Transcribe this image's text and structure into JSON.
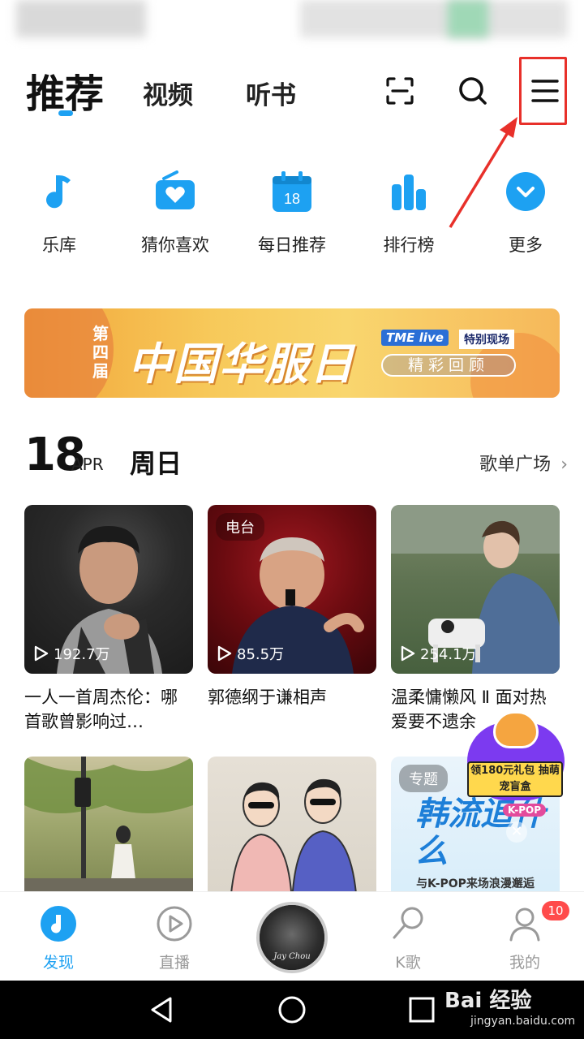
{
  "top_tabs": {
    "active": "推荐",
    "video": "视频",
    "book": "听书"
  },
  "quick_entries": [
    {
      "label": "乐库",
      "icon": "music-note-icon"
    },
    {
      "label": "猜你喜欢",
      "icon": "radio-heart-icon"
    },
    {
      "label": "每日推荐",
      "icon": "calendar-icon",
      "day": "18"
    },
    {
      "label": "排行榜",
      "icon": "bar-chart-icon"
    },
    {
      "label": "更多",
      "icon": "chevron-down-circle-icon"
    }
  ],
  "banner": {
    "prefix": "第四届",
    "title": "中国华服日",
    "brand": "TME live",
    "badge": "特别现场",
    "cta": "精彩回顾"
  },
  "date_header": {
    "day": "18",
    "month": "APR",
    "weekday": "周日",
    "link": "歌单广场"
  },
  "cards_row1": [
    {
      "title": "一人一首周杰伦：哪首歌曾影响过…",
      "plays": "192.7万",
      "tag": ""
    },
    {
      "title": "郭德纲于谦相声",
      "plays": "85.5万",
      "tag": "电台"
    },
    {
      "title": "温柔慵懒风 Ⅱ 面对热爱要不遗余",
      "plays": "254.1万",
      "tag": ""
    }
  ],
  "cards_row2": [
    {
      "tag": ""
    },
    {
      "tag": ""
    },
    {
      "tag": "专题",
      "art_title": "韩流追什么",
      "art_badge": "K-POP",
      "art_sub": "与K-POP来场浪漫邂逅"
    }
  ],
  "promo": {
    "text": "领180元礼包 抽萌宠盲盒"
  },
  "bottom_nav": [
    {
      "label": "发现",
      "icon": "discover-icon",
      "active": true
    },
    {
      "label": "直播",
      "icon": "live-play-icon",
      "active": false
    },
    {
      "label": "K歌",
      "icon": "microphone-icon",
      "active": false
    },
    {
      "label": "我的",
      "icon": "user-icon",
      "active": false
    }
  ],
  "now_playing": {
    "disc_text": "Jay Chou"
  },
  "profile_badge": "10",
  "watermark": {
    "main": "Bai 经验",
    "sub": "jingyan.baidu.com"
  },
  "colors": {
    "accent": "#1da1f2",
    "annotation": "#e8302a",
    "badge": "#ff4b4b"
  }
}
